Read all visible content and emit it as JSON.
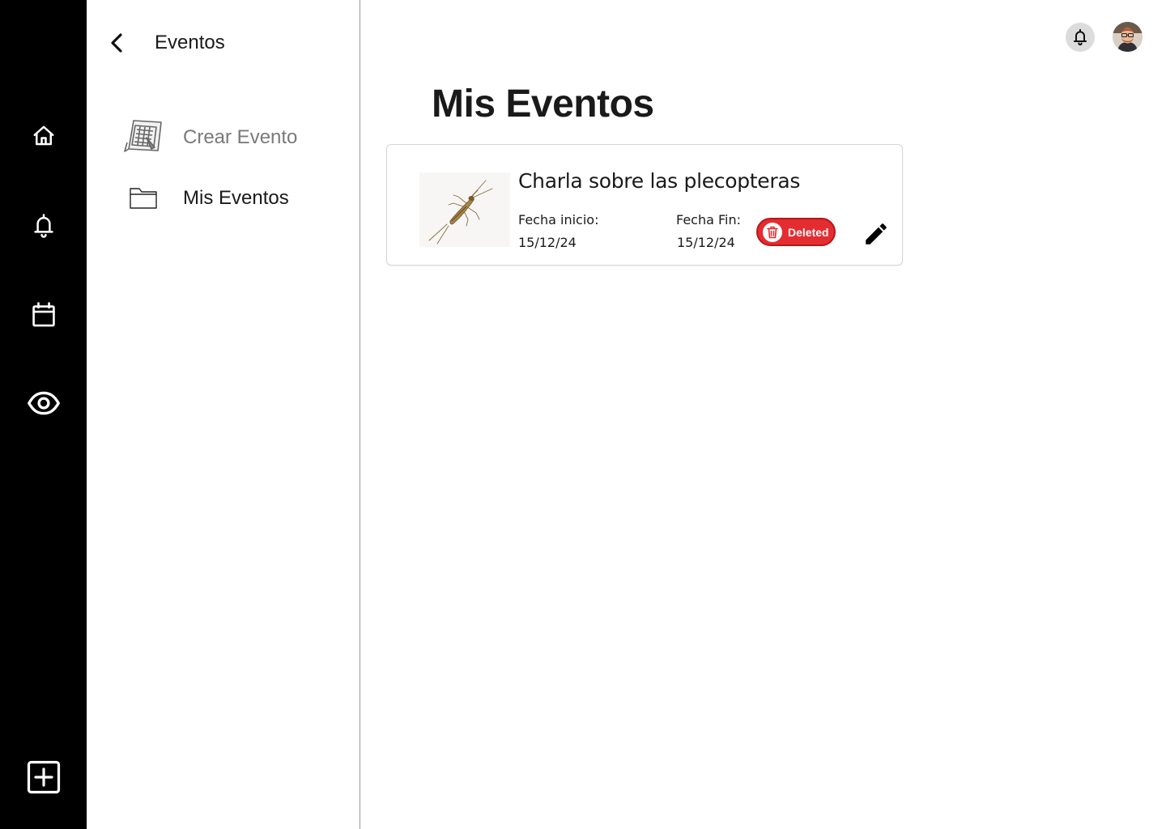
{
  "rail": {
    "items": [
      {
        "icon": "home-icon"
      },
      {
        "icon": "bell-icon"
      },
      {
        "icon": "calendar-icon"
      },
      {
        "icon": "eye-icon"
      }
    ],
    "add_icon": "plus-square-icon"
  },
  "subnav": {
    "title": "Eventos",
    "items": [
      {
        "label": "Crear Evento",
        "icon": "create-event-icon"
      },
      {
        "label": "Mis Eventos",
        "icon": "folder-icon"
      }
    ]
  },
  "topbar": {
    "notification_icon": "bell-icon",
    "avatar_icon": "user-avatar"
  },
  "main": {
    "title": "Mis Eventos",
    "events": [
      {
        "title": "Charla sobre las plecopteras",
        "start_label": "Fecha inicio:",
        "start_date": "15/12/24",
        "end_label": "Fecha Fin:",
        "end_date": "15/12/24",
        "delete_label": "Deleted",
        "thumbnail": "stonefly-image"
      }
    ]
  },
  "colors": {
    "rail_bg": "#000000",
    "delete_red": "#e42d31",
    "muted_text": "#7a7a7a"
  }
}
